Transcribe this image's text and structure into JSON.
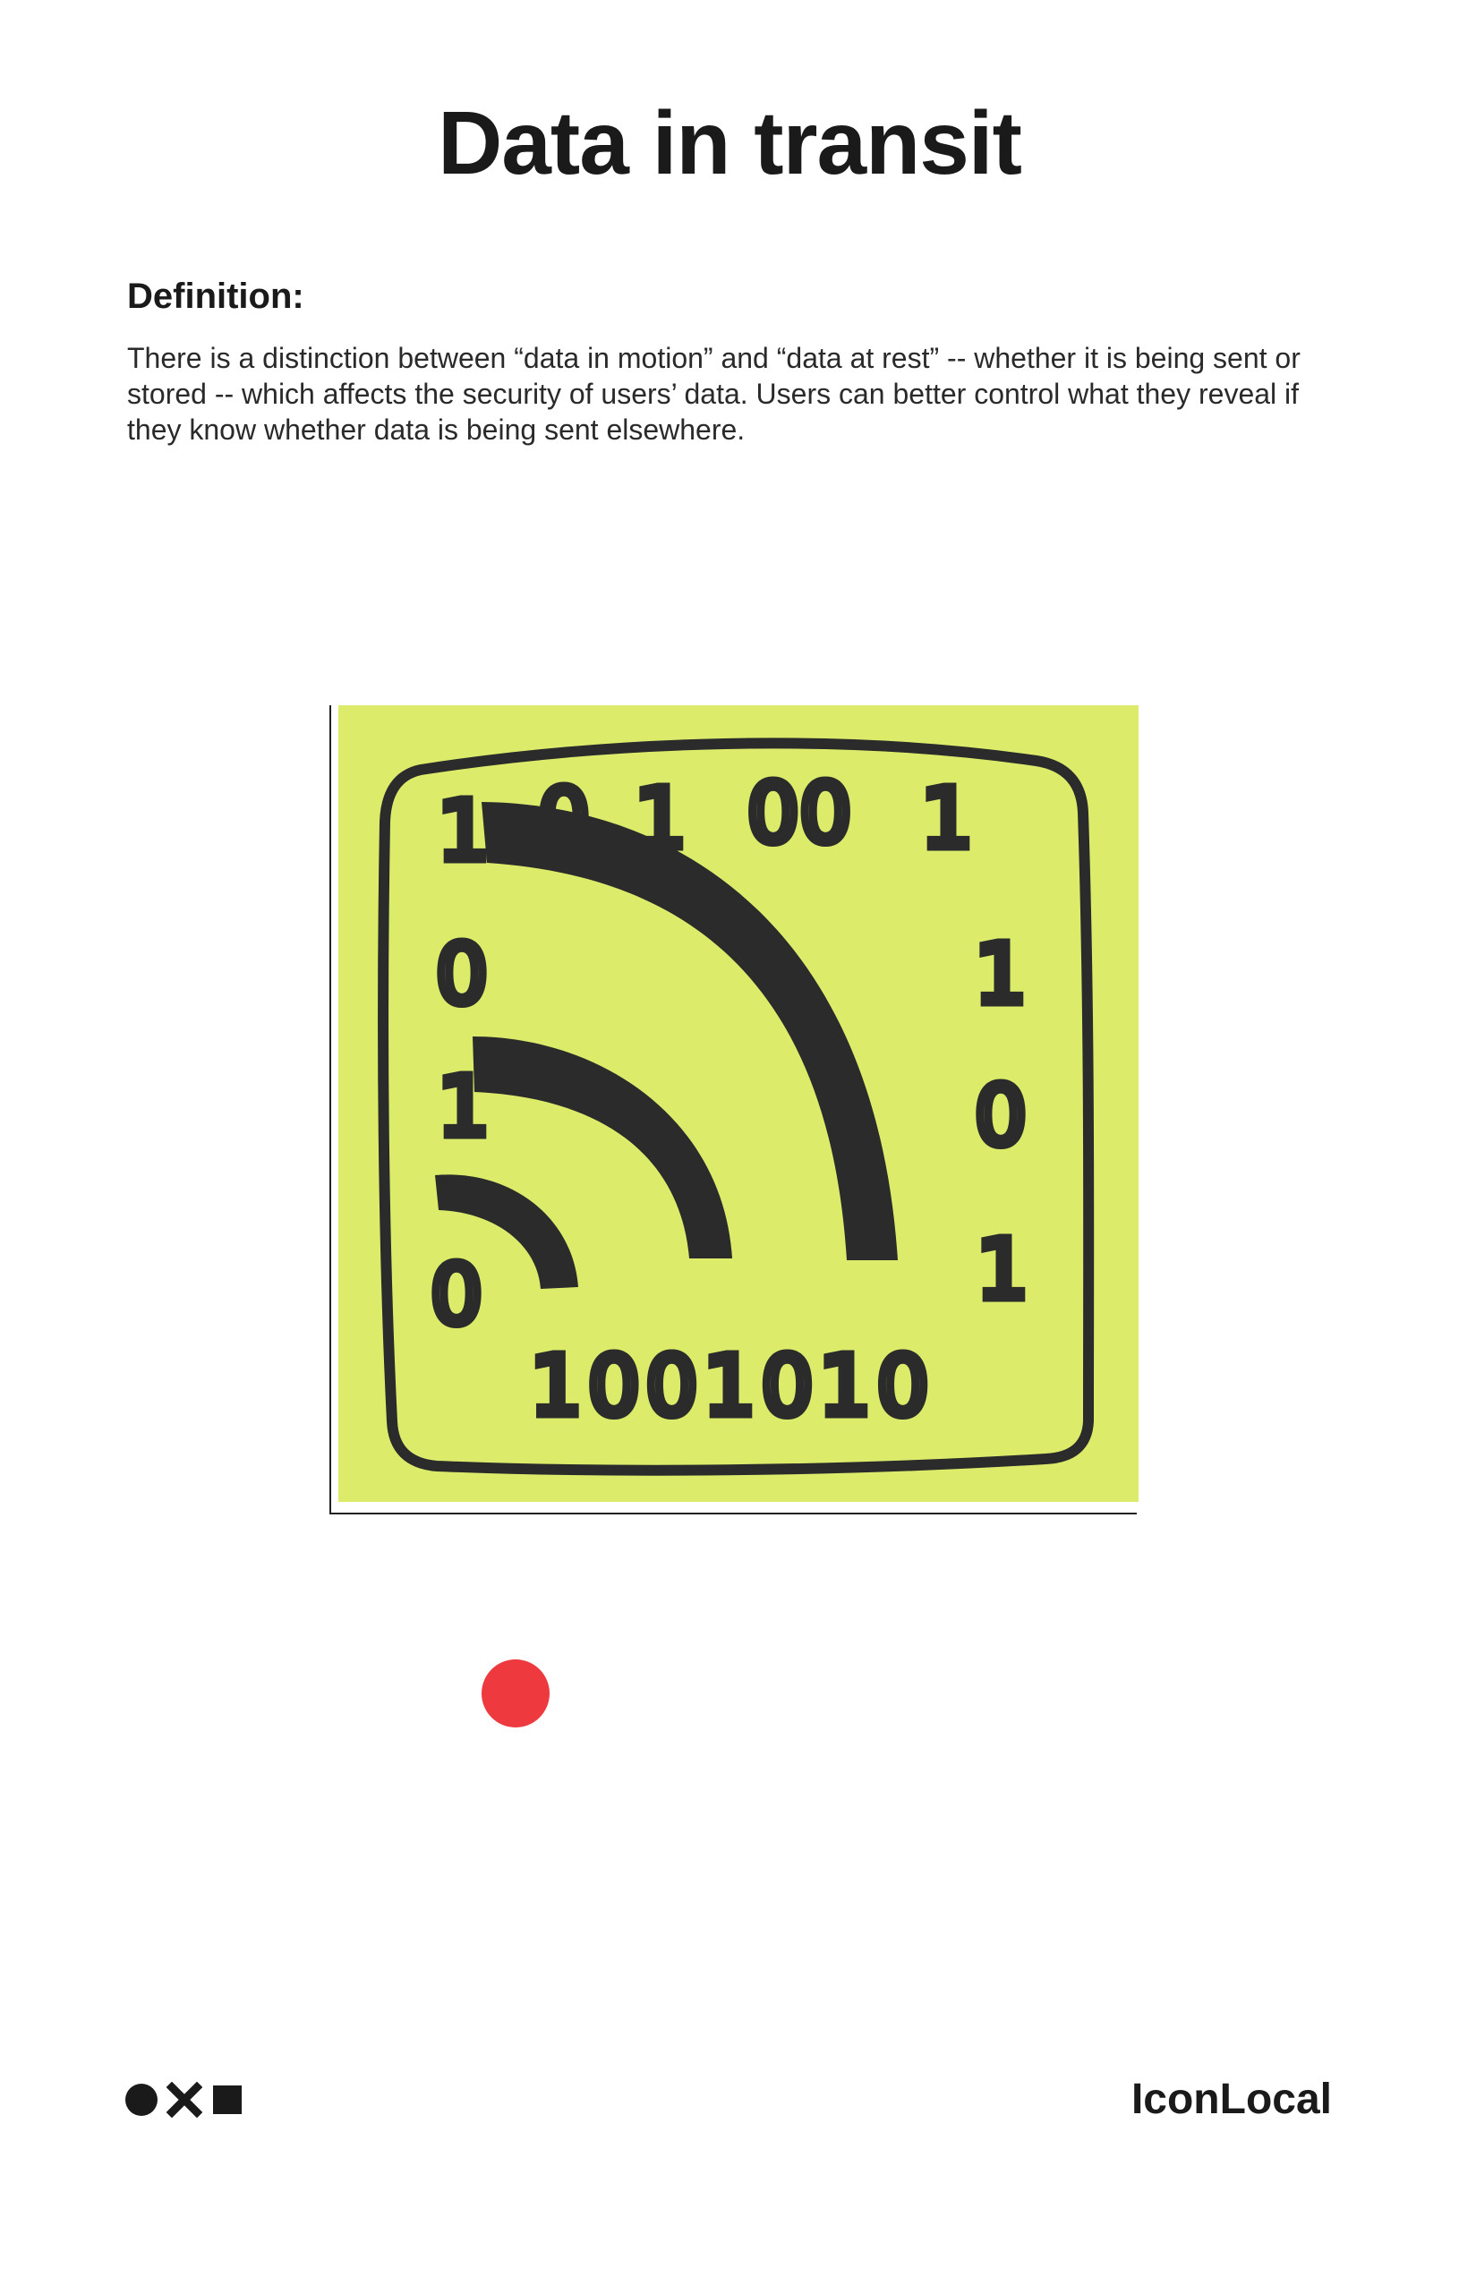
{
  "page": {
    "title": "Data in transit",
    "definition_heading": "Definition:",
    "definition_text": "There is a distinction between “data in motion” and “data at rest” -- whether it is being sent or stored -- which affects the security of users’ data. Users can better control what they reveal if they know whether data is being sent elsewhere."
  },
  "illustration": {
    "note_color": "#dcec6a",
    "ink_color": "#2b2b2b",
    "top_row": [
      "1",
      "0",
      "1",
      "00",
      "1"
    ],
    "left_column": [
      "0",
      "1",
      "0"
    ],
    "right_column": [
      "1",
      "0",
      "1"
    ],
    "bottom_row": "1001010",
    "icon": "wireless-signal-icon"
  },
  "marker": {
    "color": "#ee3a3f"
  },
  "footer": {
    "marks": [
      "circle-mark-icon",
      "x-mark-icon",
      "square-mark-icon"
    ],
    "brand": "IconLocal"
  }
}
